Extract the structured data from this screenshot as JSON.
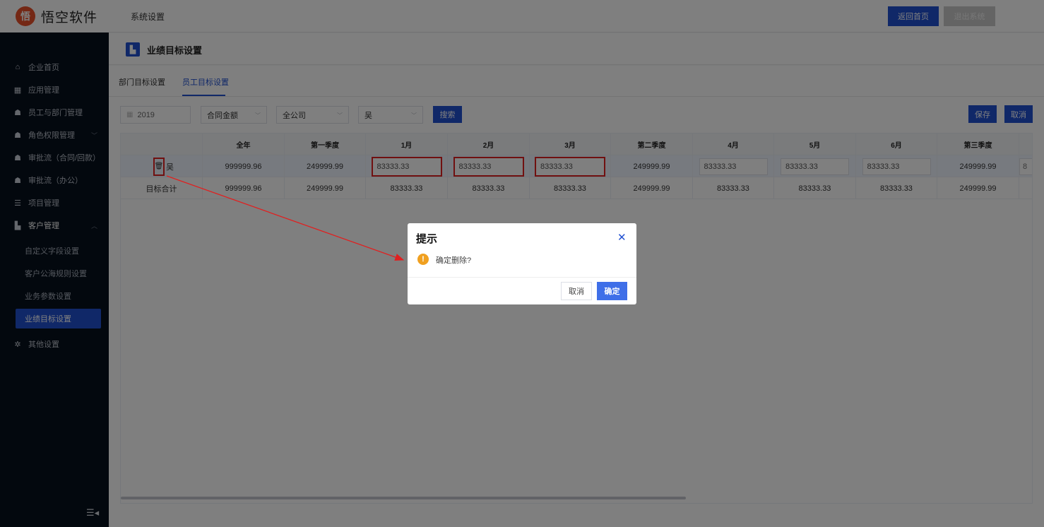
{
  "app": {
    "logo_text": "悟空软件",
    "logo_mark": "悟"
  },
  "topbar": {
    "title": "系统设置",
    "home_label": "返回首页",
    "exit_label": "退出系统"
  },
  "sidebar": {
    "items": [
      {
        "label": "企业首页",
        "icon": "home-icon",
        "glyph": "⌂"
      },
      {
        "label": "应用管理",
        "icon": "grid-icon",
        "glyph": "▦"
      },
      {
        "label": "员工与部门管理",
        "icon": "users-icon",
        "glyph": "☗"
      },
      {
        "label": "角色权限管理",
        "icon": "user-icon",
        "glyph": "☗",
        "chevron": "﹀"
      },
      {
        "label": "审批流（合同/回款）",
        "icon": "user-icon",
        "glyph": "☗"
      },
      {
        "label": "审批流（办公）",
        "icon": "user-icon",
        "glyph": "☗"
      },
      {
        "label": "项目管理",
        "icon": "list-icon",
        "glyph": "☰"
      },
      {
        "label": "客户管理",
        "icon": "building-icon",
        "glyph": "▙",
        "chevron": "︿"
      },
      {
        "label": "其他设置",
        "icon": "gear-icon",
        "glyph": "✲"
      }
    ],
    "sub_items": [
      {
        "label": "自定义字段设置"
      },
      {
        "label": "客户公海规则设置"
      },
      {
        "label": "业务参数设置"
      },
      {
        "label": "业绩目标设置"
      }
    ],
    "collapse_glyph": "☰◂"
  },
  "page": {
    "title": "业绩目标设置",
    "icon_glyph": "▙"
  },
  "tabs": [
    {
      "label": "部门目标设置"
    },
    {
      "label": "员工目标设置"
    }
  ],
  "filters": {
    "year": "2019",
    "type": "合同金额",
    "company": "全公司",
    "person": "吴",
    "calendar_glyph": "▦",
    "caret": "﹀"
  },
  "buttons": {
    "search": "搜索",
    "save": "保存",
    "cancel": "取消"
  },
  "table": {
    "columns": [
      "",
      "全年",
      "第一季度",
      "1月",
      "2月",
      "3月",
      "第二季度",
      "4月",
      "5月",
      "6月",
      "第三季度"
    ],
    "row1": {
      "name": "吴",
      "trash_glyph": "🗑",
      "values": [
        "999999.96",
        "249999.99",
        "83333.33",
        "83333.33",
        "83333.33",
        "249999.99",
        "83333.33",
        "83333.33",
        "83333.33",
        "249999.99"
      ],
      "overflow_value": "8"
    },
    "row2": {
      "name": "目标合计",
      "values": [
        "999999.96",
        "249999.99",
        "83333.33",
        "83333.33",
        "83333.33",
        "249999.99",
        "83333.33",
        "83333.33",
        "83333.33",
        "249999.99"
      ]
    }
  },
  "dialog": {
    "title": "提示",
    "close_glyph": "✕",
    "warn_glyph": "!",
    "message": "确定删除?",
    "cancel_label": "取消",
    "ok_label": "确定"
  },
  "colors": {
    "primary": "#2150d1",
    "sidebar_bg": "#07101d",
    "highlight": "#e02020",
    "warning": "#f0a020"
  }
}
